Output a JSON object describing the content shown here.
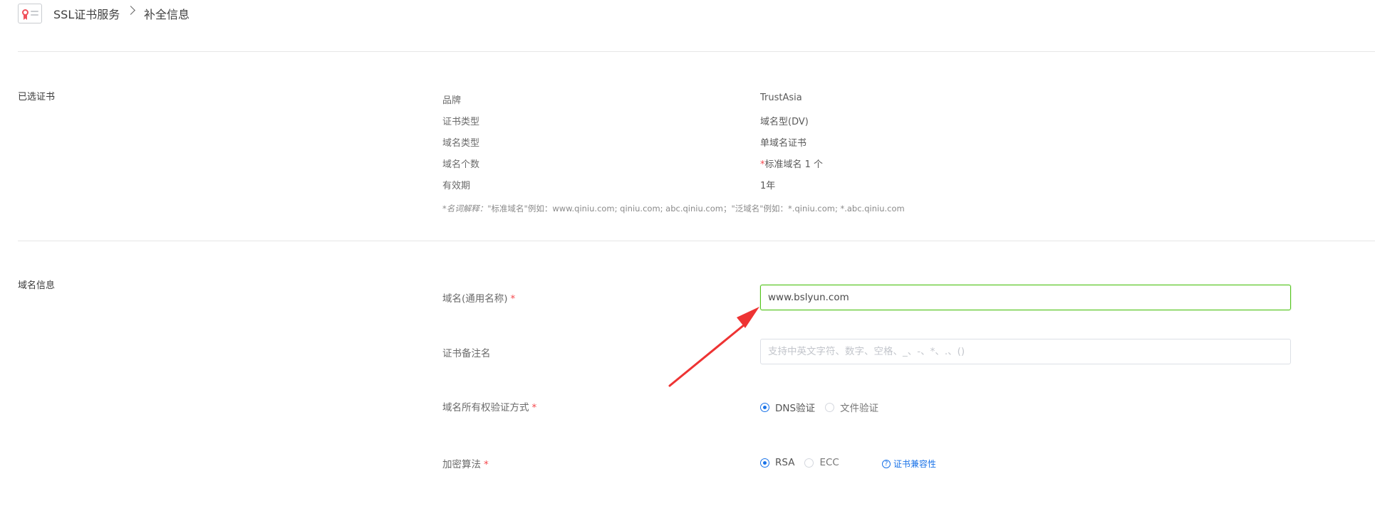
{
  "breadcrumb": {
    "root": "SSL证书服务",
    "current": "补全信息"
  },
  "selected_cert": {
    "section_title": "已选证书",
    "rows": [
      {
        "key": "品牌",
        "value": "TrustAsia"
      },
      {
        "key": "证书类型",
        "value": "域名型(DV)"
      },
      {
        "key": "域名类型",
        "value": "单域名证书"
      },
      {
        "key": "域名个数",
        "value_prefix": "*",
        "value": "标准域名 1 个"
      },
      {
        "key": "有效期",
        "value": "1年"
      }
    ],
    "note_label": "*名词解释：",
    "note_text": "\"标准域名\"例如：www.qiniu.com; qiniu.com; abc.qiniu.com；\"泛域名\"例如：*.qiniu.com; *.abc.qiniu.com"
  },
  "domain_info": {
    "section_title": "域名信息",
    "common_name": {
      "label": "域名(通用名称)",
      "required": "*",
      "value": "www.bslyun.com"
    },
    "remark": {
      "label": "证书备注名",
      "placeholder": "支持中英文字符、数字、空格、_、-、*、.、()"
    },
    "verify": {
      "label": "域名所有权验证方式",
      "required": "*",
      "options": [
        "DNS验证",
        "文件验证"
      ],
      "selected": "DNS验证"
    },
    "algo": {
      "label": "加密算法",
      "required": "*",
      "options": [
        "RSA",
        "ECC"
      ],
      "selected": "RSA",
      "compat_link": "证书兼容性"
    }
  },
  "colors": {
    "accent": "#1a73e8",
    "required": "#f5484d",
    "active_border": "#52c41a",
    "annotation_arrow": "#ee3333"
  },
  "icons": [
    "certificate-icon",
    "chevron-right-icon",
    "help-circle-icon",
    "annotation-arrow"
  ]
}
